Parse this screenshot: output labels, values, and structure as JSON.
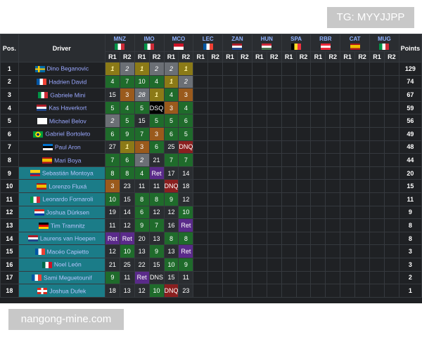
{
  "watermark_top": "TG: MYYJJPP",
  "watermark_bottom": "nangong-mine.com",
  "headers": {
    "pos": "Pos.",
    "driver": "Driver",
    "points": "Points",
    "r1": "R1",
    "r2": "R2"
  },
  "venues": [
    {
      "code": "MNZ",
      "flag": "flag-italy"
    },
    {
      "code": "IMO",
      "flag": "flag-italy"
    },
    {
      "code": "MCO",
      "flag": "flag-monaco"
    },
    {
      "code": "LEC",
      "flag": "flag-france"
    },
    {
      "code": "ZAN",
      "flag": "flag-netherlands"
    },
    {
      "code": "HUN",
      "flag": "flag-hungary"
    },
    {
      "code": "SPA",
      "flag": "flag-belgium"
    },
    {
      "code": "RBR",
      "flag": "flag-austria"
    },
    {
      "code": "CAT",
      "flag": "flag-spain"
    },
    {
      "code": "MUG",
      "flag": "flag-italy"
    }
  ],
  "rows": [
    {
      "pos": "1",
      "driver": "Dino Beganovic",
      "flag": "flag-sweden",
      "points": "129",
      "teal": false,
      "results": [
        {
          "v": "1",
          "c": "gold"
        },
        {
          "v": "2",
          "c": "silver"
        },
        {
          "v": "1",
          "c": "gold"
        },
        {
          "v": "2",
          "c": "silver"
        },
        {
          "v": "2",
          "c": "silver"
        },
        {
          "v": "1",
          "c": "gold"
        }
      ]
    },
    {
      "pos": "2",
      "driver": "Hadrien David",
      "flag": "flag-france",
      "points": "74",
      "teal": false,
      "results": [
        {
          "v": "4",
          "c": "green"
        },
        {
          "v": "7",
          "c": "green"
        },
        {
          "v": "10",
          "c": "green"
        },
        {
          "v": "4",
          "c": "green"
        },
        {
          "v": "1",
          "c": "gold"
        },
        {
          "v": "2",
          "c": "silver"
        }
      ]
    },
    {
      "pos": "3",
      "driver": "Gabriele Mini",
      "flag": "flag-italy",
      "points": "67",
      "teal": false,
      "results": [
        {
          "v": "15",
          "c": "blank"
        },
        {
          "v": "3",
          "c": "bronze"
        },
        {
          "v": "28",
          "c": "silver"
        },
        {
          "v": "1",
          "c": "gold"
        },
        {
          "v": "4",
          "c": "green"
        },
        {
          "v": "3",
          "c": "bronze"
        }
      ]
    },
    {
      "pos": "4",
      "driver": "Kas Haverkort",
      "flag": "flag-netherlands",
      "points": "59",
      "teal": false,
      "results": [
        {
          "v": "5",
          "c": "green"
        },
        {
          "v": "4",
          "c": "green"
        },
        {
          "v": "5",
          "c": "green"
        },
        {
          "v": "DSQ",
          "c": "black"
        },
        {
          "v": "3",
          "c": "bronze"
        },
        {
          "v": "4",
          "c": "green"
        }
      ]
    },
    {
      "pos": "5",
      "driver": "Michael Belov",
      "flag": "flag-fia",
      "points": "56",
      "teal": false,
      "results": [
        {
          "v": "2",
          "c": "silver"
        },
        {
          "v": "5",
          "c": "green"
        },
        {
          "v": "15",
          "c": "blank"
        },
        {
          "v": "5",
          "c": "green"
        },
        {
          "v": "5",
          "c": "green"
        },
        {
          "v": "6",
          "c": "green"
        }
      ]
    },
    {
      "pos": "6",
      "driver": "Gabriel Bortoleto",
      "flag": "flag-brazil",
      "points": "49",
      "teal": false,
      "results": [
        {
          "v": "6",
          "c": "green"
        },
        {
          "v": "9",
          "c": "green"
        },
        {
          "v": "7",
          "c": "green"
        },
        {
          "v": "3",
          "c": "bronze"
        },
        {
          "v": "6",
          "c": "green"
        },
        {
          "v": "5",
          "c": "green"
        }
      ]
    },
    {
      "pos": "7",
      "driver": "Paul Aron",
      "flag": "flag-estonia",
      "points": "48",
      "teal": false,
      "results": [
        {
          "v": "27",
          "c": "blank"
        },
        {
          "v": "1",
          "c": "gold"
        },
        {
          "v": "3",
          "c": "bronze"
        },
        {
          "v": "6",
          "c": "green"
        },
        {
          "v": "25",
          "c": "blank"
        },
        {
          "v": "DNQ",
          "c": "red"
        }
      ]
    },
    {
      "pos": "8",
      "driver": "Mari Boya",
      "flag": "flag-spain",
      "points": "44",
      "teal": false,
      "results": [
        {
          "v": "7",
          "c": "green"
        },
        {
          "v": "6",
          "c": "green"
        },
        {
          "v": "2",
          "c": "silver"
        },
        {
          "v": "21",
          "c": "blank"
        },
        {
          "v": "7",
          "c": "green"
        },
        {
          "v": "7",
          "c": "green"
        }
      ]
    },
    {
      "pos": "9",
      "driver": "Sebastián Montoya",
      "flag": "flag-colombia",
      "points": "20",
      "teal": true,
      "results": [
        {
          "v": "8",
          "c": "green"
        },
        {
          "v": "8",
          "c": "green"
        },
        {
          "v": "4",
          "c": "green"
        },
        {
          "v": "Ret",
          "c": "purple"
        },
        {
          "v": "17",
          "c": "blank"
        },
        {
          "v": "14",
          "c": "blank"
        }
      ]
    },
    {
      "pos": "10",
      "driver": "Lorenzo Fluxá",
      "flag": "flag-spain",
      "points": "15",
      "teal": true,
      "results": [
        {
          "v": "3",
          "c": "bronze"
        },
        {
          "v": "23",
          "c": "blank"
        },
        {
          "v": "11",
          "c": "blank"
        },
        {
          "v": "11",
          "c": "blank"
        },
        {
          "v": "DNQ",
          "c": "red"
        },
        {
          "v": "18",
          "c": "blank"
        }
      ]
    },
    {
      "pos": "11",
      "driver": "Leonardo Fornaroli",
      "flag": "flag-italy",
      "points": "11",
      "teal": true,
      "results": [
        {
          "v": "10",
          "c": "green"
        },
        {
          "v": "15",
          "c": "blank"
        },
        {
          "v": "8",
          "c": "green"
        },
        {
          "v": "8",
          "c": "green"
        },
        {
          "v": "9",
          "c": "green"
        },
        {
          "v": "12",
          "c": "blank"
        }
      ]
    },
    {
      "pos": "12",
      "driver": "Joshua Dürksen",
      "flag": "flag-paraguay",
      "points": "9",
      "teal": true,
      "results": [
        {
          "v": "19",
          "c": "blank"
        },
        {
          "v": "14",
          "c": "blank"
        },
        {
          "v": "6",
          "c": "green"
        },
        {
          "v": "12",
          "c": "blank"
        },
        {
          "v": "12",
          "c": "blank"
        },
        {
          "v": "10",
          "c": "green"
        }
      ]
    },
    {
      "pos": "13",
      "driver": "Tim Tramnitz",
      "flag": "flag-germany",
      "points": "8",
      "teal": true,
      "results": [
        {
          "v": "11",
          "c": "blank"
        },
        {
          "v": "12",
          "c": "blank"
        },
        {
          "v": "9",
          "c": "green"
        },
        {
          "v": "7",
          "c": "green"
        },
        {
          "v": "16",
          "c": "blank"
        },
        {
          "v": "Ret",
          "c": "purple"
        }
      ]
    },
    {
      "pos": "14",
      "driver": "Laurens van Hoepen",
      "flag": "flag-netherlands",
      "points": "8",
      "teal": true,
      "results": [
        {
          "v": "Ret",
          "c": "purple"
        },
        {
          "v": "Ret",
          "c": "purple"
        },
        {
          "v": "20",
          "c": "blank"
        },
        {
          "v": "13",
          "c": "blank"
        },
        {
          "v": "8",
          "c": "green"
        },
        {
          "v": "8",
          "c": "green"
        }
      ]
    },
    {
      "pos": "15",
      "driver": "Macéo Capietto",
      "flag": "flag-france",
      "points": "3",
      "teal": true,
      "results": [
        {
          "v": "12",
          "c": "blank"
        },
        {
          "v": "10",
          "c": "green"
        },
        {
          "v": "13",
          "c": "blank"
        },
        {
          "v": "9",
          "c": "green"
        },
        {
          "v": "13",
          "c": "blank"
        },
        {
          "v": "Ret",
          "c": "purple"
        }
      ]
    },
    {
      "pos": "16",
      "driver": "Noel León",
      "flag": "flag-mexico",
      "points": "3",
      "teal": true,
      "results": [
        {
          "v": "21",
          "c": "blank"
        },
        {
          "v": "25",
          "c": "blank"
        },
        {
          "v": "22",
          "c": "blank"
        },
        {
          "v": "15",
          "c": "blank"
        },
        {
          "v": "10",
          "c": "green"
        },
        {
          "v": "9",
          "c": "green"
        }
      ]
    },
    {
      "pos": "17",
      "driver": "Sami Meguetounif",
      "flag": "flag-france",
      "points": "2",
      "teal": true,
      "results": [
        {
          "v": "9",
          "c": "green"
        },
        {
          "v": "11",
          "c": "blank"
        },
        {
          "v": "Ret",
          "c": "purple"
        },
        {
          "v": "DNS",
          "c": "blank"
        },
        {
          "v": "15",
          "c": "blank"
        },
        {
          "v": "11",
          "c": "blank"
        }
      ]
    },
    {
      "pos": "18",
      "driver": "Joshua Dufek",
      "flag": "flag-switzerland",
      "points": "1",
      "teal": true,
      "results": [
        {
          "v": "18",
          "c": "blank"
        },
        {
          "v": "13",
          "c": "blank"
        },
        {
          "v": "12",
          "c": "blank"
        },
        {
          "v": "10",
          "c": "green"
        },
        {
          "v": "DNQ",
          "c": "red"
        },
        {
          "v": "23",
          "c": "blank"
        }
      ]
    }
  ]
}
